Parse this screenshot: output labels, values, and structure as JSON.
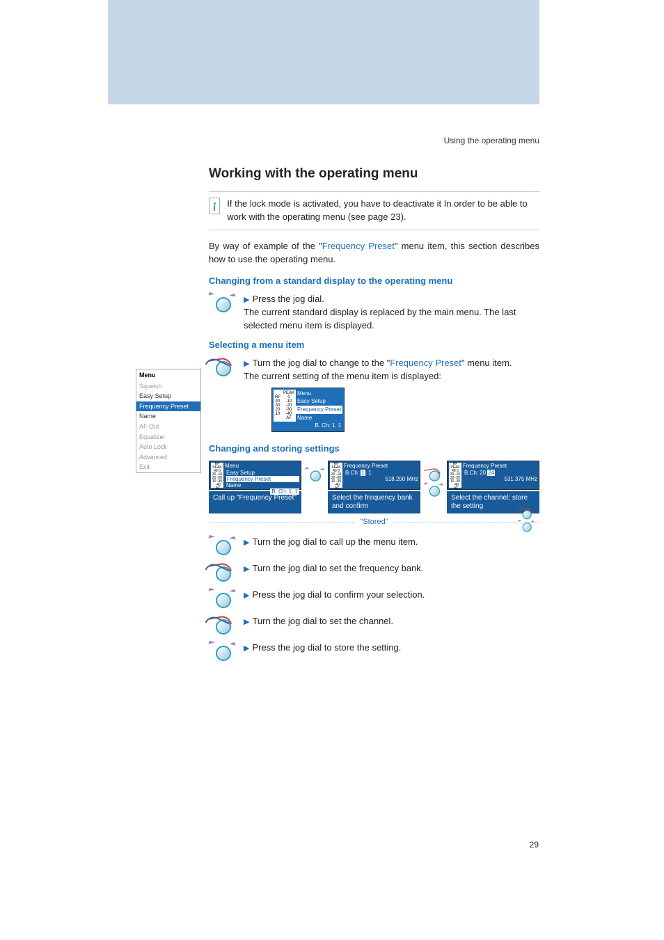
{
  "running_head": "Using the operating menu",
  "h2": "Working with the operating menu",
  "info_box": "If the lock mode is activated, you have to deactivate it In order to be able to work with the operating menu (see page 23).",
  "intro_pre": "By way of example of the \"",
  "intro_link": "Frequency Preset",
  "intro_post": "\" menu item, this section describes how to use the operating menu.",
  "sub1": "Changing from a standard display to the operating menu",
  "step1a": "Press the jog dial.",
  "step1b": "The current standard display is replaced by the main menu. The last selected menu item is displayed.",
  "sub2": "Selecting a menu item",
  "step2a_pre": "Turn the jog dial to change to the \"",
  "step2a_link": "Frequency Preset",
  "step2a_post": "\" menu item.",
  "step2b": "The current setting of the menu item is displayed:",
  "sub3": "Changing and storing settings",
  "flow": {
    "card1": {
      "hdr": "Menu",
      "l1": "Easy Setup",
      "l2": "Frequency Preset",
      "l3": "Name",
      "foot": "B. Ch:   1. 1",
      "cap": "Call up \"Frequency Preset\""
    },
    "card2": {
      "hdr": "Frequency Preset",
      "l1": "B.Ch:  1. 1",
      "l2": "518.200 MHz",
      "cap": "Select the frequency bank and confirm"
    },
    "card3": {
      "hdr": "Frequency Preset",
      "l1": "B.Ch:  20.24",
      "l2": "531.375 MHz",
      "cap": "Select the channel; store the setting"
    }
  },
  "stored": "\"Stored\"",
  "tail1": "Turn the jog dial to call up the menu item.",
  "tail2": "Turn the jog dial to set the frequency bank.",
  "tail3": "Press the jog dial to confirm your selection.",
  "tail4": "Turn the jog dial to set the channel.",
  "tail5": "Press the jog dial to store the setting.",
  "page_num": "29",
  "sidebar": {
    "title": "Menu",
    "items": [
      "Squelch",
      "Easy Setup",
      "Frequency Preset",
      "Name",
      "AF Out",
      "Equalizer",
      "Auto Lock",
      "Advanced",
      "Exit"
    ],
    "selected_index": 2,
    "dark_index": 3
  },
  "lcd_small": {
    "title": "Menu",
    "l1": "Easy Setup",
    "l2": "Frequency Preset",
    "l3": "Name",
    "foot": "B. Ch:   1. 1",
    "meter_left_label": "RF",
    "meter_right_label": "AF",
    "peak": "PEAK",
    "levels_left": [
      "40",
      "30",
      "20",
      "10"
    ],
    "levels_right": [
      "0",
      "-10",
      "-20",
      "-30",
      "-40"
    ]
  }
}
